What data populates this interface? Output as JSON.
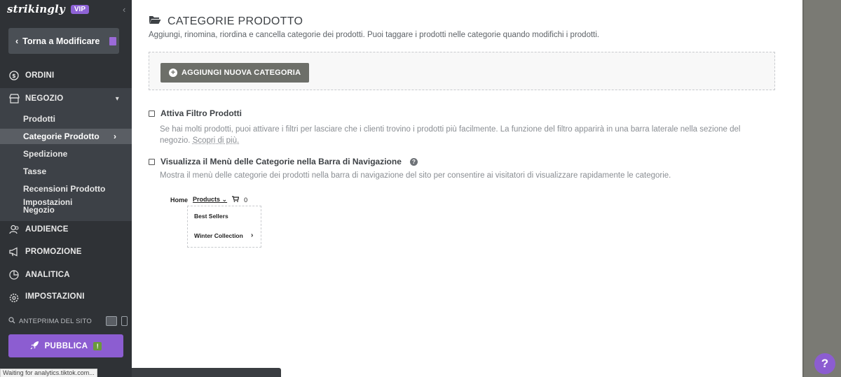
{
  "sidebar": {
    "brand": "strikingly",
    "vip_badge": "VIP",
    "back_button": "Torna a Modificare",
    "nav": {
      "orders": "ORDINI",
      "shop": "NEGOZIO",
      "audience": "AUDIENCE",
      "promotion": "PROMOZIONE",
      "analytics": "ANALITICA",
      "settings": "IMPOSTAZIONI"
    },
    "shop_submenu": {
      "products": "Prodotti",
      "categories": "Categorie Prodotto",
      "shipping": "Spedizione",
      "taxes": "Tasse",
      "reviews": "Recensioni Prodotto",
      "shop_settings_line1": "Impostazioni",
      "shop_settings_line2": "Negozio"
    },
    "preview_label": "ANTEPRIMA DEL SITO",
    "publish_button": "PUBBLICA",
    "publish_warning": "!"
  },
  "status_bar": "Waiting for analytics.tiktok.com...",
  "main": {
    "title": "CATEGORIE PRODOTTO",
    "subtitle": "Aggiungi, rinomina, riordina e cancella categorie dei prodotti. Puoi taggare i prodotti nelle categorie quando modifichi i prodotti.",
    "add_category_button": "AGGIUNGI NUOVA CATEGORIA",
    "filter_option": {
      "label": "Attiva Filtro Prodotti",
      "checked": false,
      "description": "Se hai molti prodotti, puoi attivare i filtri per lasciare che i clienti trovino i prodotti più facilmente. La funzione del filtro apparirà in una barra laterale nella sezione del negozio.",
      "learn_more": "Scopri di più."
    },
    "nav_menu_option": {
      "label": "Visualizza il Menù delle Categorie nella Barra di Navigazione",
      "checked": false,
      "description": "Mostra il menù delle categorie dei prodotti nella barra di navigazione del sito per consentire ai visitatori di visualizzare rapidamente le categorie."
    },
    "menu_preview": {
      "home": "Home",
      "products": "Products",
      "cart_count": "0",
      "items": [
        "Best Sellers",
        "Winter Collection"
      ]
    }
  },
  "help_button": "?",
  "colors": {
    "sidebar_bg": "#2f3236",
    "accent_purple": "#8c5dd1",
    "add_button_bg": "#6d6f69"
  }
}
